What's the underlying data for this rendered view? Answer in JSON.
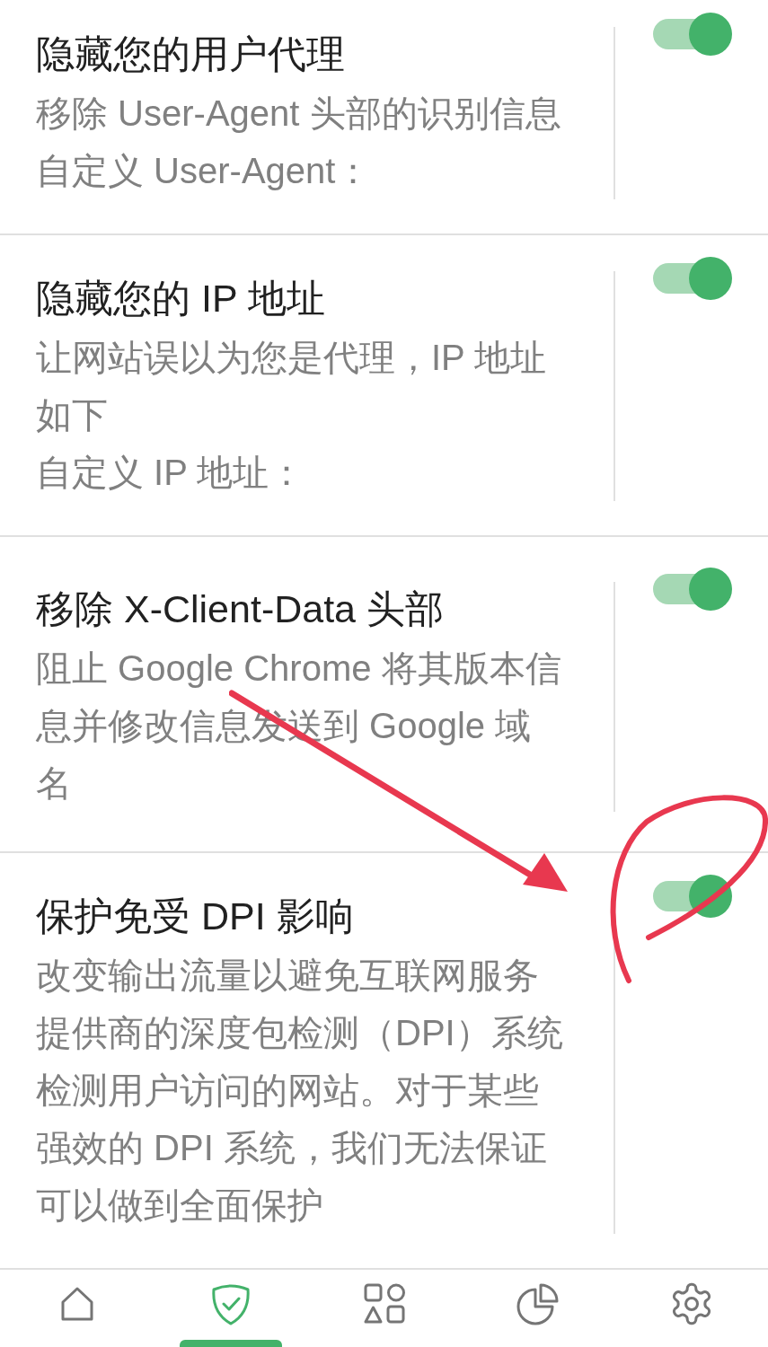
{
  "settings": [
    {
      "title": "隐藏您的用户代理",
      "description": "移除 User-Agent 头部的识别信息",
      "custom": "自定义 User-Agent：",
      "on": true
    },
    {
      "title": "隐藏您的 IP 地址",
      "description": "让网站误以为您是代理，IP 地址如下",
      "custom": "自定义 IP 地址：",
      "on": true
    },
    {
      "title": "移除 X-Client-Data 头部",
      "description": "阻止 Google Chrome 将其版本信息并修改信息发送到 Google 域名",
      "on": true
    },
    {
      "title": "保护免受 DPI 影响",
      "description": "改变输出流量以避免互联网服务提供商的深度包检测（DPI）系统检测用户访问的网站。对于某些强效的 DPI 系统，我们无法保证可以做到全面保护",
      "on": true
    }
  ],
  "nav": [
    {
      "kind": "home",
      "selected": false
    },
    {
      "kind": "shield",
      "selected": true
    },
    {
      "kind": "apps",
      "selected": false
    },
    {
      "kind": "stats",
      "selected": false
    },
    {
      "kind": "settings",
      "selected": false
    }
  ]
}
